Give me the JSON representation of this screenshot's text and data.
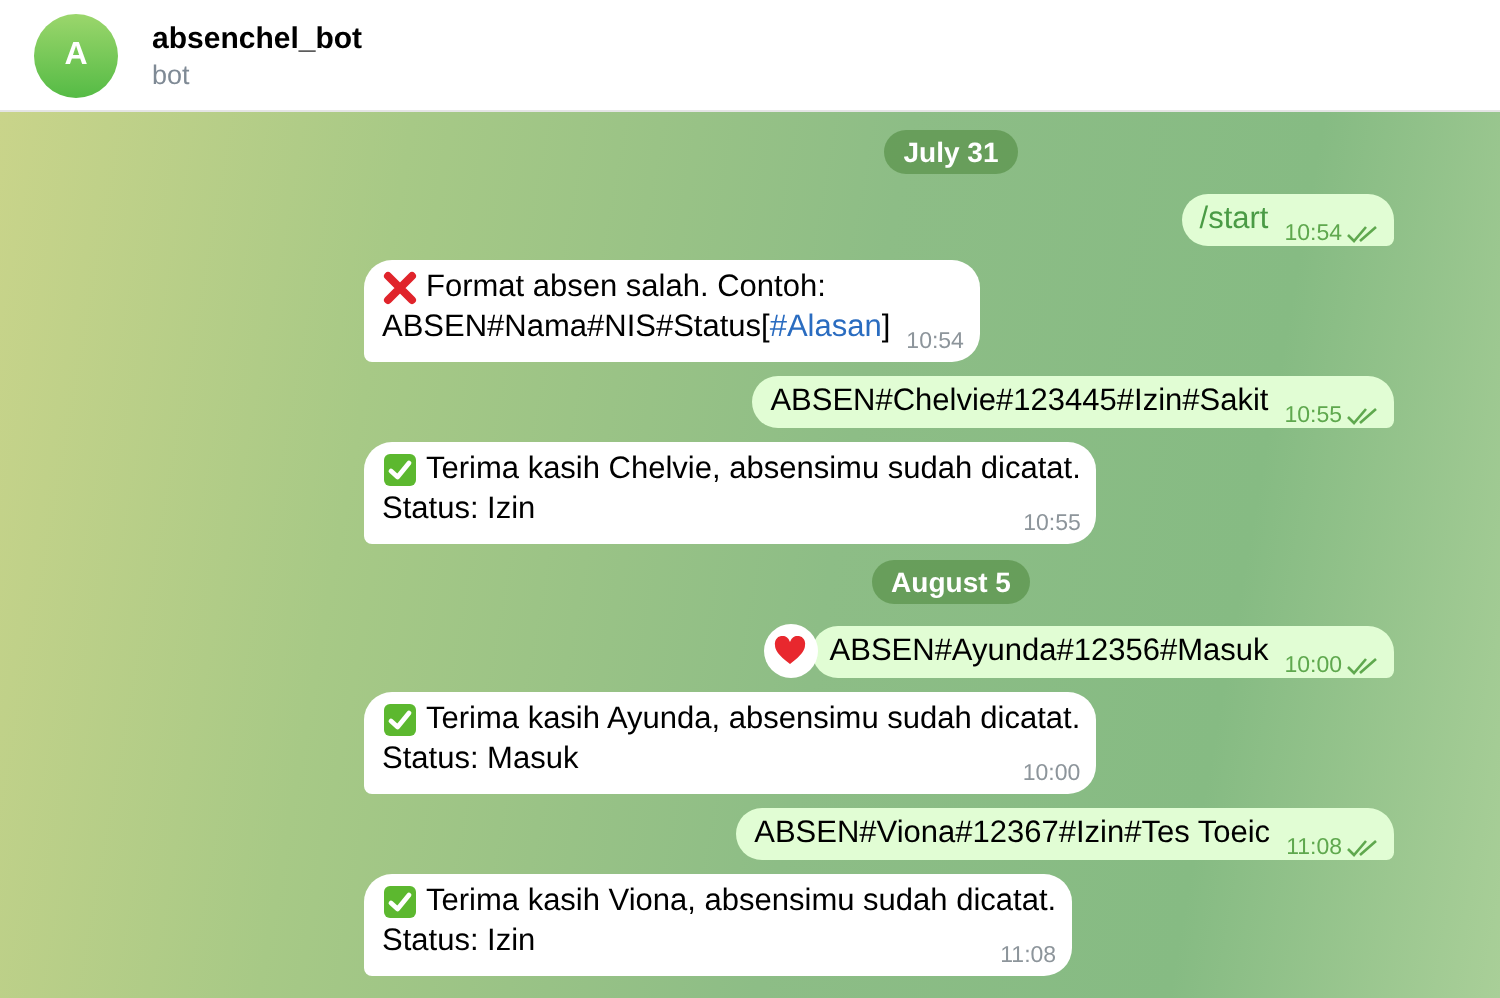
{
  "header": {
    "avatar_letter": "A",
    "title": "absenchel_bot",
    "subtitle": "bot"
  },
  "messages": [
    {
      "kind": "date",
      "text": "July 31"
    },
    {
      "kind": "out",
      "lines": [
        [
          {
            "text": "/start",
            "kind": "command"
          }
        ]
      ],
      "time": "10:54",
      "read": true
    },
    {
      "kind": "in",
      "success": false,
      "lines": [
        [
          {
            "text": "Format absen salah. Contoh:"
          }
        ],
        [
          {
            "text": "ABSEN#Nama#NIS#Status["
          },
          {
            "text": "#Alasan",
            "kind": "link"
          },
          {
            "text": "]"
          }
        ]
      ],
      "time": "10:54"
    },
    {
      "kind": "out",
      "lines": [
        [
          {
            "text": "ABSEN#Chelvie#123445#Izin#Sakit"
          }
        ]
      ],
      "time": "10:55",
      "read": true
    },
    {
      "kind": "in",
      "success": true,
      "lines": [
        [
          {
            "text": "Terima kasih Chelvie, absensimu sudah dicatat."
          }
        ],
        [
          {
            "text": "Status: Izin"
          }
        ]
      ],
      "time": "10:55"
    },
    {
      "kind": "date",
      "text": "August 5"
    },
    {
      "kind": "out",
      "reacted": true,
      "lines": [
        [
          {
            "text": "ABSEN#Ayunda#12356#Masuk"
          }
        ]
      ],
      "time": "10:00",
      "read": true
    },
    {
      "kind": "in",
      "success": true,
      "lines": [
        [
          {
            "text": "Terima kasih Ayunda, absensimu sudah dicatat."
          }
        ],
        [
          {
            "text": "Status: Masuk"
          }
        ]
      ],
      "time": "10:00"
    },
    {
      "kind": "out",
      "lines": [
        [
          {
            "text": "ABSEN#Viona#12367#Izin#Tes Toeic"
          }
        ]
      ],
      "time": "11:08",
      "read": true
    },
    {
      "kind": "in",
      "success": true,
      "lines": [
        [
          {
            "text": "Terima kasih Viona, absensimu sudah dicatat."
          }
        ],
        [
          {
            "text": "Status: Izin"
          }
        ]
      ],
      "time": "11:08"
    }
  ]
}
